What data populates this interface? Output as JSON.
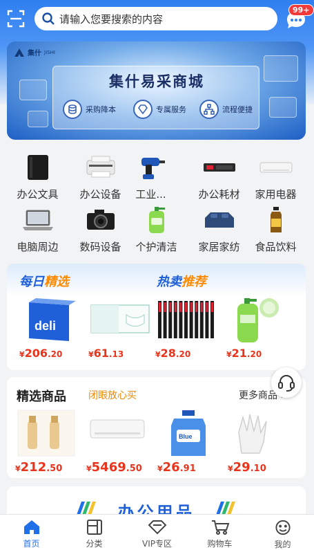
{
  "header": {
    "search_placeholder": "请输入您要搜索的内容",
    "message_badge": "99+",
    "icons": {
      "scan": "scan-icon",
      "search": "search-icon",
      "message": "chat-bubble-icon"
    }
  },
  "banner": {
    "logo_name": "集什",
    "logo_sub": "JISHI",
    "title": "集什易采商城",
    "features": [
      "采购降本",
      "专属服务",
      "流程便捷"
    ]
  },
  "categories": [
    {
      "label": "办公文具",
      "icon": "folder-icon"
    },
    {
      "label": "办公设备",
      "icon": "printer-icon"
    },
    {
      "label": "工业...",
      "icon": "drill-icon"
    },
    {
      "label": "办公耗材",
      "icon": "toner-icon"
    },
    {
      "label": "家用电器",
      "icon": "air-conditioner-icon"
    },
    {
      "label": "电脑周边",
      "icon": "laptop-icon"
    },
    {
      "label": "数码设备",
      "icon": "camera-icon"
    },
    {
      "label": "个护清洁",
      "icon": "hand-soap-icon"
    },
    {
      "label": "家居家纺",
      "icon": "bedding-icon"
    },
    {
      "label": "食品饮料",
      "icon": "beverage-icon"
    }
  ],
  "daily": {
    "title_a": "每日",
    "title_a_hi": "精选",
    "title_b": "热卖",
    "title_b_hi": "推荐",
    "products": [
      {
        "currency": "¥",
        "int": "206",
        "dec": ".20",
        "icon": "a4-paper-box-icon"
      },
      {
        "currency": "¥",
        "int": "61",
        "dec": ".13",
        "icon": "mask-box-icon"
      },
      {
        "currency": "¥",
        "int": "28",
        "dec": ".20",
        "icon": "gel-pens-icon"
      },
      {
        "currency": "¥",
        "int": "21",
        "dec": ".20",
        "icon": "hand-soap-bottle-icon"
      }
    ]
  },
  "selected": {
    "title": "精选商品",
    "subtitle": "闭眼放心买",
    "more": "更多商品",
    "products": [
      {
        "currency": "¥",
        "int": "212",
        "dec": ".50",
        "icon": "skincare-bottles-icon"
      },
      {
        "currency": "¥",
        "int": "5469",
        "dec": ".50",
        "icon": "air-conditioner-icon"
      },
      {
        "currency": "¥",
        "int": "26",
        "dec": ".91",
        "icon": "detergent-bottle-icon"
      },
      {
        "currency": "¥",
        "int": "29",
        "dec": ".10",
        "icon": "work-gloves-icon"
      }
    ]
  },
  "office": {
    "title": "办公用品"
  },
  "tabbar": [
    {
      "label": "首页",
      "icon": "home-icon",
      "active": true
    },
    {
      "label": "分类",
      "icon": "category-icon",
      "active": false
    },
    {
      "label": "VIP专区",
      "icon": "vip-diamond-icon",
      "active": false
    },
    {
      "label": "购物车",
      "icon": "cart-icon",
      "active": false
    },
    {
      "label": "我的",
      "icon": "profile-icon",
      "active": false
    }
  ],
  "colors": {
    "brand_blue": "#1f6fe8",
    "price_red": "#e8341c",
    "accent_orange": "#ff8a00"
  }
}
